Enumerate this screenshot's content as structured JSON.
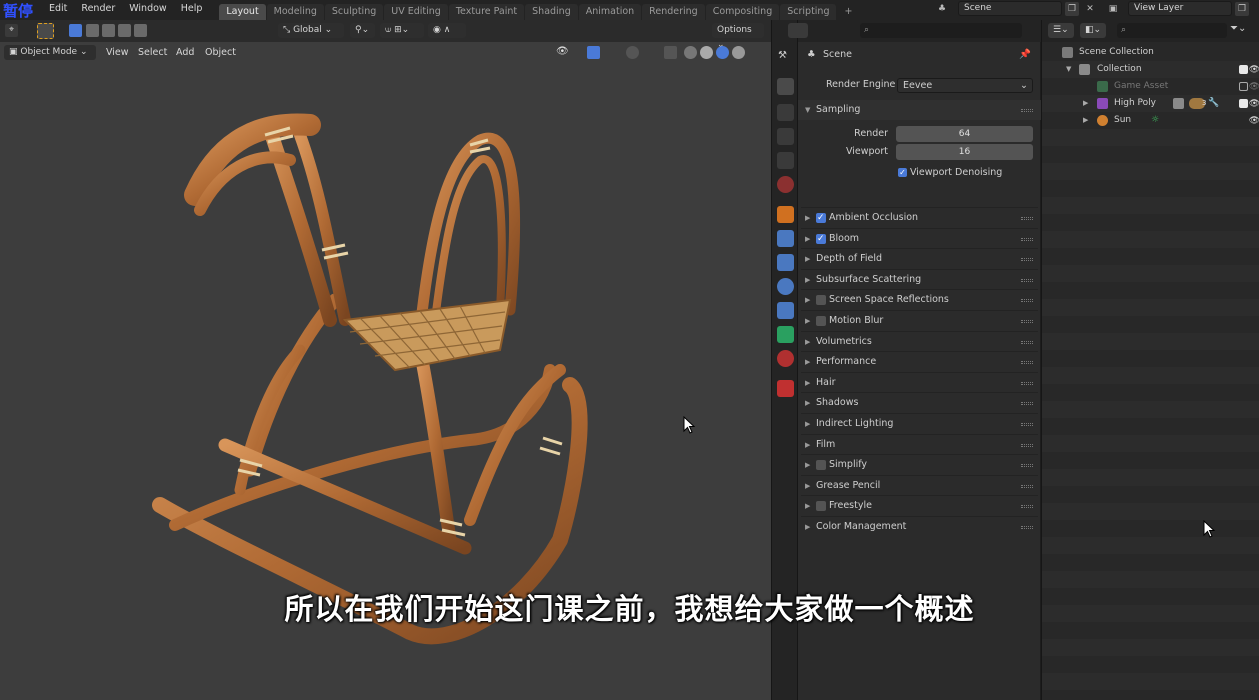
{
  "logo_tag": "暂停",
  "menu": [
    "Edit",
    "Render",
    "Window",
    "Help"
  ],
  "workspace_tabs": [
    "Layout",
    "Modeling",
    "Sculpting",
    "UV Editing",
    "Texture Paint",
    "Shading",
    "Animation",
    "Rendering",
    "Compositing",
    "Scripting"
  ],
  "active_workspace": "Layout",
  "plus_tab": "+",
  "scene_field": "Scene",
  "view_layer_field": "View Layer",
  "viewport": {
    "mode": "Object Mode",
    "menus": [
      "View",
      "Select",
      "Add",
      "Object"
    ],
    "transform_orientation": "Global",
    "options_label": "Options"
  },
  "subtitle": "所以在我们开始这门课之前，我想给大家做一个概述",
  "properties": {
    "context_label": "Scene",
    "render_engine_label": "Render Engine",
    "render_engine_value": "Eevee",
    "sampling": {
      "title": "Sampling",
      "render_label": "Render",
      "render_value": "64",
      "viewport_label": "Viewport",
      "viewport_value": "16",
      "denoise_label": "Viewport Denoising"
    },
    "panels": [
      {
        "label": "Ambient Occlusion",
        "checkbox": true,
        "checked": true
      },
      {
        "label": "Bloom",
        "checkbox": true,
        "checked": true
      },
      {
        "label": "Depth of Field",
        "checkbox": false,
        "checked": false
      },
      {
        "label": "Subsurface Scattering",
        "checkbox": false,
        "checked": false
      },
      {
        "label": "Screen Space Reflections",
        "checkbox": true,
        "checked": false
      },
      {
        "label": "Motion Blur",
        "checkbox": true,
        "checked": false
      },
      {
        "label": "Volumetrics",
        "checkbox": false,
        "checked": false
      },
      {
        "label": "Performance",
        "checkbox": false,
        "checked": false
      },
      {
        "label": "Hair",
        "checkbox": false,
        "checked": false
      },
      {
        "label": "Shadows",
        "checkbox": false,
        "checked": false
      },
      {
        "label": "Indirect Lighting",
        "checkbox": false,
        "checked": false
      },
      {
        "label": "Film",
        "checkbox": false,
        "checked": false
      },
      {
        "label": "Simplify",
        "checkbox": true,
        "checked": false
      },
      {
        "label": "Grease Pencil",
        "checkbox": false,
        "checked": false
      },
      {
        "label": "Freestyle",
        "checkbox": true,
        "checked": false
      },
      {
        "label": "Color Management",
        "checkbox": false,
        "checked": false
      }
    ]
  },
  "outliner": {
    "scene_collection": "Scene Collection",
    "collection": "Collection",
    "items": [
      "Game Asset",
      "High Poly",
      "Sun"
    ],
    "high_poly_badge": "3"
  },
  "colors": {
    "accent_blue": "#4a7ad8",
    "active_tab": "#4a4a4a",
    "viewport_bg": "#3d3d3d",
    "wood": "#b8743a"
  }
}
